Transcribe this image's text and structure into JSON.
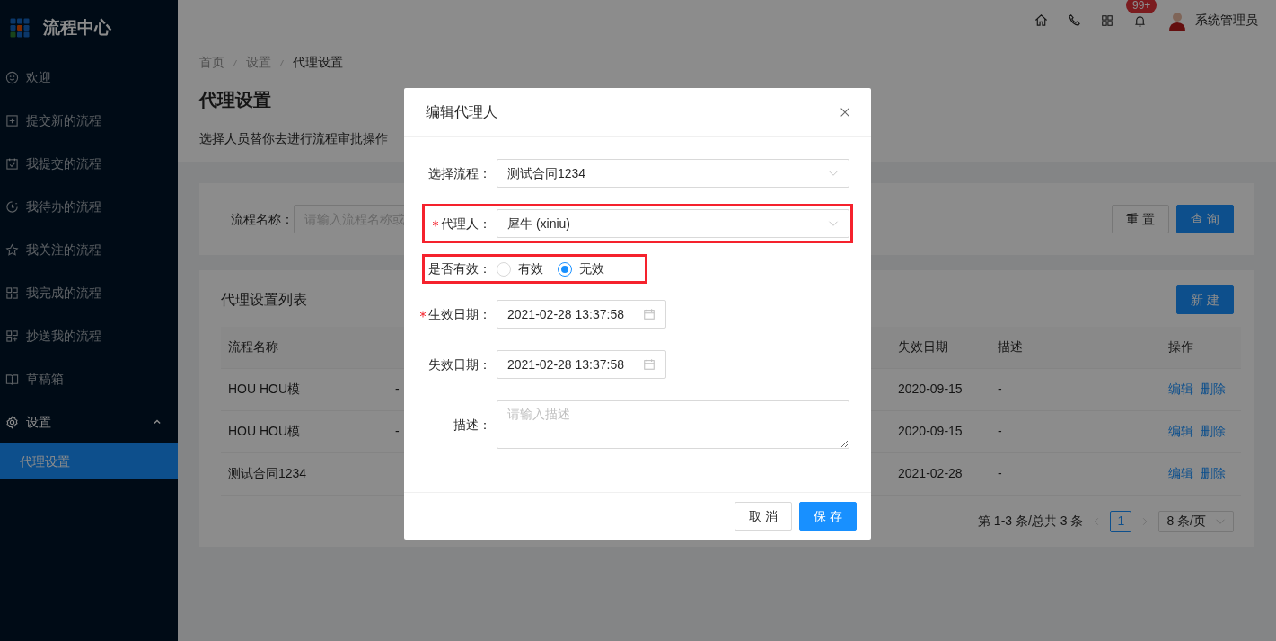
{
  "app": {
    "title": "流程中心"
  },
  "sidebar": {
    "items": [
      {
        "label": "欢迎",
        "selected": false
      },
      {
        "label": "提交新的流程",
        "selected": false
      },
      {
        "label": "我提交的流程",
        "selected": false
      },
      {
        "label": "我待办的流程",
        "selected": false
      },
      {
        "label": "我关注的流程",
        "selected": false
      },
      {
        "label": "我完成的流程",
        "selected": false
      },
      {
        "label": "抄送我的流程",
        "selected": false
      },
      {
        "label": "草稿箱",
        "selected": false
      },
      {
        "label": "设置",
        "selected": false,
        "expanded": true,
        "children": [
          {
            "label": "代理设置",
            "selected": true
          }
        ]
      }
    ]
  },
  "header": {
    "notification_badge": "99+",
    "user": "系统管理员"
  },
  "breadcrumb": [
    "首页",
    "设置",
    "代理设置"
  ],
  "page_title": "代理设置",
  "page_description": "选择人员替你去进行流程审批操作",
  "search": {
    "label": "流程名称：",
    "placeholder": "请输入流程名称或",
    "buttons": [
      {
        "label": "重 置",
        "kind": "default"
      },
      {
        "label": "查 询",
        "kind": "primary"
      }
    ]
  },
  "table": {
    "title": "代理设置列表",
    "new_button": "新 建",
    "columns": [
      "流程名称",
      null,
      "失效日期",
      "描述",
      "操作"
    ],
    "rows": [
      {
        "cells": [
          "HOU HOU模",
          "-",
          "2020-09-15",
          "-"
        ],
        "actions": [
          "编辑",
          "删除"
        ]
      },
      {
        "cells": [
          "HOU HOU模",
          "-",
          "2020-09-15",
          "-"
        ],
        "actions": [
          "编辑",
          "删除"
        ]
      },
      {
        "cells": [
          "测试合同1234",
          null,
          "2021-02-28",
          "-"
        ],
        "actions": [
          "编辑",
          "删除"
        ]
      }
    ],
    "pagination": {
      "summary": "第 1-3 条/总共 3 条",
      "pages": [
        {
          "label": "1",
          "selected": true
        }
      ],
      "page_size": "8 条/页"
    }
  },
  "modal": {
    "title": "编辑代理人",
    "fields": [
      {
        "kind": "select",
        "label": "选择流程：",
        "value": "测试合同1234",
        "required": false,
        "highlighted": false
      },
      {
        "kind": "select",
        "label": "代理人：",
        "value": "犀牛 (xiniu)",
        "required": true,
        "highlighted": true
      },
      {
        "kind": "radio",
        "label": "是否有效：",
        "options": [
          {
            "label": "有效",
            "selected": false
          },
          {
            "label": "无效",
            "selected": true
          }
        ],
        "required": false,
        "highlighted": true
      },
      {
        "kind": "date",
        "label": "生效日期：",
        "value": "2021-02-28 13:37:58",
        "required": true,
        "highlighted": false
      },
      {
        "kind": "date",
        "label": "失效日期：",
        "value": "2021-02-28 13:37:58",
        "required": false,
        "highlighted": false
      },
      {
        "kind": "textarea",
        "label": "描述：",
        "placeholder": "请输入描述",
        "required": false,
        "highlighted": false
      }
    ],
    "buttons": [
      {
        "label": "取 消",
        "kind": "default"
      },
      {
        "label": "保 存",
        "kind": "primary"
      }
    ]
  }
}
